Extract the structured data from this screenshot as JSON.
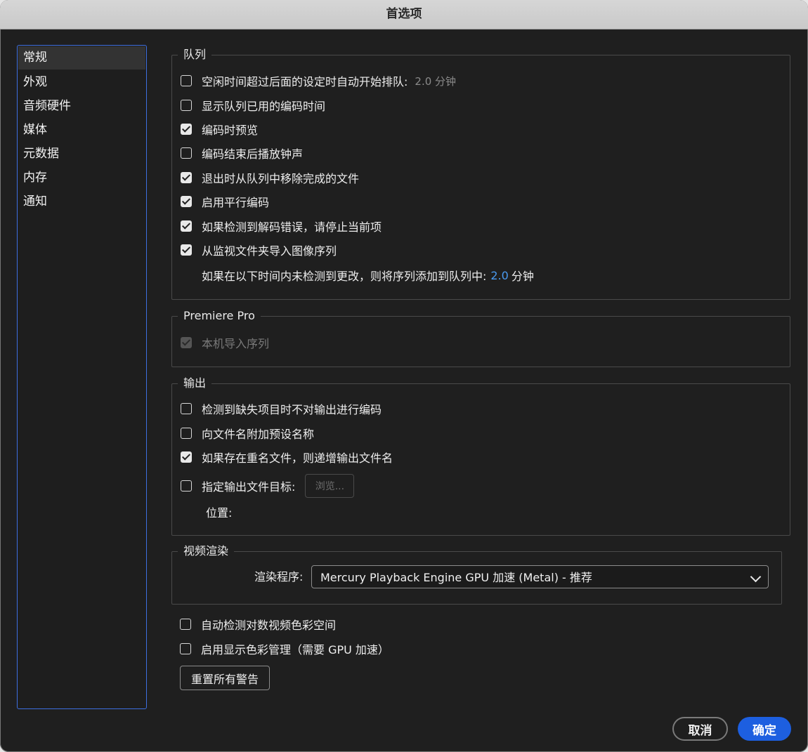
{
  "window": {
    "title": "首选项"
  },
  "sidebar": {
    "items": [
      {
        "label": "常规"
      },
      {
        "label": "外观"
      },
      {
        "label": "音频硬件"
      },
      {
        "label": "媒体"
      },
      {
        "label": "元数据"
      },
      {
        "label": "内存"
      },
      {
        "label": "通知"
      }
    ]
  },
  "queue": {
    "title": "队列",
    "auto_start": {
      "label": "空闲时间超过后面的设定时自动开始排队:",
      "value": "2.0 分钟",
      "checked": false
    },
    "show_time": {
      "label": "显示队列已用的编码时间",
      "checked": false
    },
    "preview": {
      "label": "编码时预览",
      "checked": true
    },
    "chime": {
      "label": "编码结束后播放钟声",
      "checked": false
    },
    "remove_on_exit": {
      "label": "退出时从队列中移除完成的文件",
      "checked": true
    },
    "parallel": {
      "label": "启用平行编码",
      "checked": true
    },
    "stop_on_error": {
      "label": "如果检测到解码错误，请停止当前项",
      "checked": true
    },
    "watch_folder": {
      "label": "从监视文件夹导入图像序列",
      "checked": true
    },
    "watch_note": {
      "label": "如果在以下时间内未检测到更改，则将序列添加到队列中:",
      "value": "2.0",
      "unit": "分钟"
    }
  },
  "premiere": {
    "title": "Premiere Pro",
    "native_import": {
      "label": "本机导入序列",
      "checked": true,
      "disabled": true
    }
  },
  "output": {
    "title": "输出",
    "skip_missing": {
      "label": "检测到缺失项目时不对输出进行编码",
      "checked": false
    },
    "append_preset": {
      "label": "向文件名附加预设名称",
      "checked": false
    },
    "increment": {
      "label": "如果存在重名文件，则递增输出文件名",
      "checked": true
    },
    "destination": {
      "label": "指定输出文件目标:",
      "checked": false,
      "browse": "浏览..."
    },
    "location_label": "位置:"
  },
  "video": {
    "title": "视频渲染",
    "renderer_label": "渲染程序:",
    "renderer_value": "Mercury Playback Engine GPU 加速 (Metal) - 推荐"
  },
  "misc": {
    "log_color": {
      "label": "自动检测对数视频色彩空间",
      "checked": false
    },
    "display_color": {
      "label": "启用显示色彩管理（需要 GPU 加速）",
      "checked": false
    },
    "reset_warnings": "重置所有警告"
  },
  "footer": {
    "cancel": "取消",
    "ok": "确定"
  }
}
